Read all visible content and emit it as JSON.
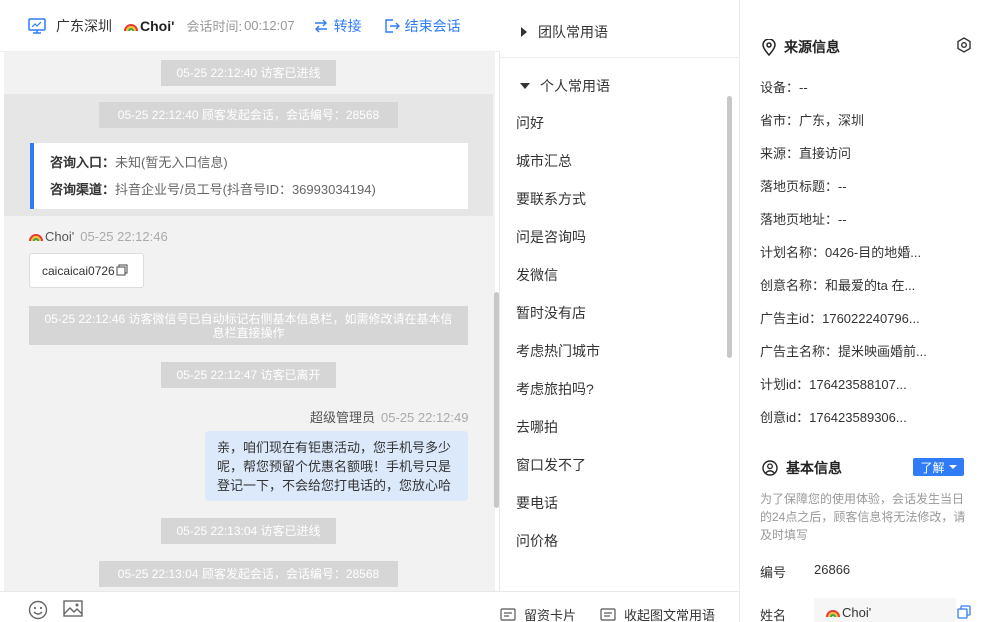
{
  "header": {
    "location": "广东深圳",
    "visitor_name": "Choi'",
    "time_label": "会话时间:",
    "time_value": "00:12:07",
    "transfer_label": "转接",
    "end_label": "结束会话"
  },
  "messages": {
    "sys1": "05-25 22:12:40 访客已进线",
    "sys2": "05-25 22:12:40 顾客发起会话，会话编号：28568",
    "entry_label": "咨询入口：",
    "entry_value": "未知(暂无入口信息)",
    "channel_label": "咨询渠道：",
    "channel_value": "抖音企业号/员工号(抖音号ID：36993034194)",
    "msg1_sender": "Choi'",
    "msg1_time": "05-25 22:12:46",
    "msg1_text": "caicaicai0726",
    "sys3": "05-25 22:12:46 访客微信号已自动标记右侧基本信息栏，如需修改请在基本信息栏直接操作",
    "sys4": "05-25 22:12:47 访客已离开",
    "msg2_sender": "超级管理员",
    "msg2_time": "05-25 22:12:49",
    "msg2_text": "亲，咱们现在有钜惠活动，您手机号多少呢，帮您预留个优惠名额哦！手机号只是登记一下，不会给您打电话的，您放心哈",
    "sys5": "05-25 22:13:04 访客已进线",
    "sys6": "05-25 22:13:04 顾客发起会话，会话编号：28568"
  },
  "phrases": {
    "team_group": "团队常用语",
    "personal_group": "个人常用语",
    "items": [
      "问好",
      "城市汇总",
      "要联系方式",
      "问是咨询吗",
      "发微信",
      "暂时没有店",
      "考虑热门城市",
      "考虑旅拍吗?",
      "去哪拍",
      "窗口发不了",
      "要电话",
      "问价格"
    ],
    "footer_card": "留资卡片",
    "footer_collect": "收起图文常用语"
  },
  "source": {
    "title": "来源信息",
    "fields": [
      "设备：--",
      "省市：广东，深圳",
      "来源：直接访问",
      "落地页标题：--",
      "落地页地址：--",
      "计划名称：0426-目的地婚...",
      "创意名称：和最爱的ta 在...",
      "广告主id：176022240796...",
      "广告主名称：提米映画婚前...",
      "计划id：176423588107...",
      "创意id：176423589306..."
    ]
  },
  "basic": {
    "title": "基本信息",
    "learn_label": "了解",
    "hint": "为了保障您的使用体验，会话发生当日的24点之后，顾客信息将无法修改，请及时填写",
    "id_label": "编号",
    "id_value": "26866",
    "name_label": "姓名",
    "name_value": "Choi'"
  },
  "colors": {
    "accent": "#2f7cf6",
    "bubble": "#dce9fb",
    "system": "#d6d6d6"
  }
}
